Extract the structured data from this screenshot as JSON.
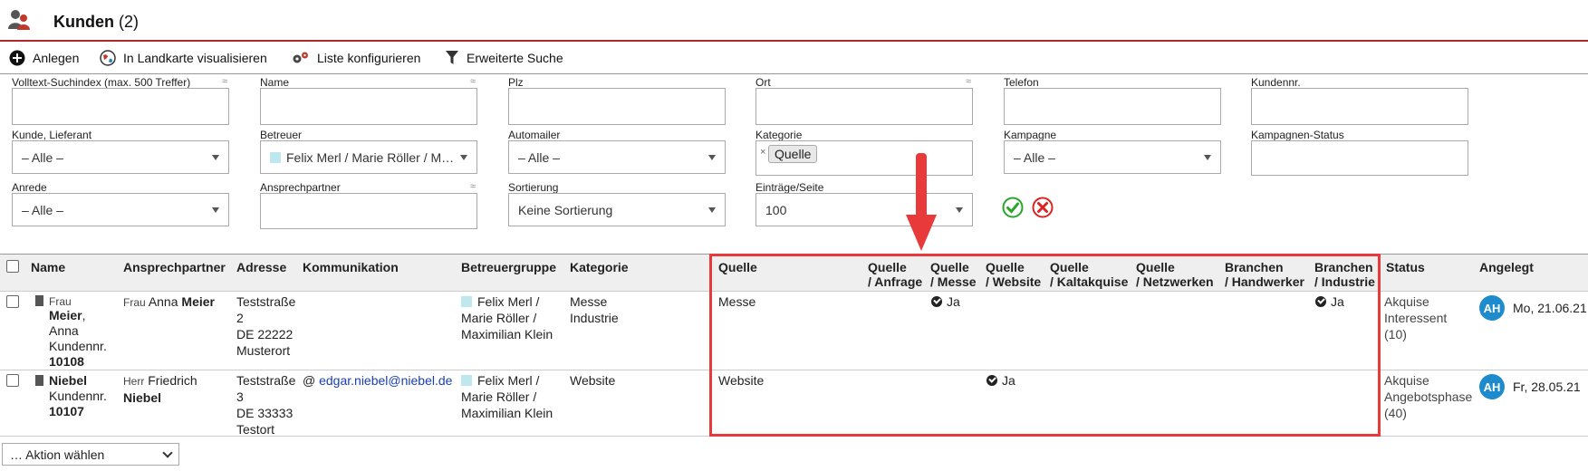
{
  "header": {
    "title": "Kunden",
    "count": "(2)"
  },
  "toolbar": {
    "add_label": "Anlegen",
    "map_label": "In Landkarte visualisieren",
    "configure_label": "Liste konfigurieren",
    "search_label": "Erweiterte Suche"
  },
  "filters": {
    "fulltext_label": "Volltext-Suchindex (max. 500 Treffer)",
    "name_label": "Name",
    "plz_label": "Plz",
    "ort_label": "Ort",
    "telefon_label": "Telefon",
    "kundennr_label": "Kundennr.",
    "kunde_label": "Kunde, Lieferant",
    "kunde_value": "– Alle –",
    "betreuer_label": "Betreuer",
    "betreuer_value": "Felix Merl / Marie Röller / M…",
    "automailer_label": "Automailer",
    "automailer_value": "– Alle –",
    "kategorie_label": "Kategorie",
    "kategorie_tag": "Quelle",
    "kampagne_label": "Kampagne",
    "kampagne_value": "– Alle –",
    "kampagnen_status_label": "Kampagnen-Status",
    "anrede_label": "Anrede",
    "anrede_value": "– Alle –",
    "ansprechpartner_label": "Ansprechpartner",
    "sortierung_label": "Sortierung",
    "sortierung_value": "Keine Sortierung",
    "eintraege_label": "Einträge/Seite",
    "eintraege_value": "100",
    "approx_symbol": "≈",
    "tag_remove": "×"
  },
  "columns": {
    "name": "Name",
    "ansprechpartner": "Ansprechpartner",
    "adresse": "Adresse",
    "kommunikation": "Kommunikation",
    "betreuergruppe": "Betreuergruppe",
    "kategorie": "Kategorie",
    "quelle": "Quelle",
    "q_anfrage_1": "Quelle",
    "q_anfrage_2": "/ Anfrage",
    "q_messe_1": "Quelle",
    "q_messe_2": "/ Messe",
    "q_website_1": "Quelle",
    "q_website_2": "/ Website",
    "q_kalt_1": "Quelle",
    "q_kalt_2": "/ Kaltakquise",
    "q_netz_1": "Quelle",
    "q_netz_2": "/ Netzwerken",
    "b_hand_1": "Branchen",
    "b_hand_2": "/ Handwerker",
    "b_ind_1": "Branchen",
    "b_ind_2": "/ Industrie",
    "status": "Status",
    "angelegt": "Angelegt"
  },
  "rows": [
    {
      "salutation": "Frau",
      "lastname": "Meier",
      "comma": ",",
      "firstname": "Anna",
      "kdnr_label": "Kundennr.",
      "kdnr": "10108",
      "contact_salutation": "Frau",
      "contact_firstname": "Anna",
      "contact_lastname": "Meier",
      "street1": "Teststraße",
      "street2": "2",
      "zip_city1": "DE 22222",
      "zip_city2": "Musterort",
      "email_symbol": "",
      "email": "",
      "group1": "Felix Merl /",
      "group2": "Marie Röller /",
      "group3": "Maximilian Klein",
      "kategorie1": "Messe",
      "kategorie2": "Industrie",
      "quelle": "Messe",
      "q_messe": "Ja",
      "q_website": "",
      "b_industrie": "Ja",
      "status1": "Akquise",
      "status2": "Interessent",
      "status3": "(10)",
      "avatar": "AH",
      "date": "Mo, 21.06.21"
    },
    {
      "salutation": "",
      "lastname": "Niebel",
      "comma": "",
      "firstname": "",
      "kdnr_label": "Kundennr.",
      "kdnr": "10107",
      "contact_salutation": "Herr",
      "contact_firstname": "Friedrich",
      "contact_lastname": "Niebel",
      "street1": "Teststraße",
      "street2": "3",
      "zip_city1": "DE 33333",
      "zip_city2": "Testort",
      "email_symbol": "@",
      "email": "edgar.niebel@niebel.de",
      "group1": "Felix Merl /",
      "group2": "Marie Röller /",
      "group3": "Maximilian Klein",
      "kategorie1": "Website",
      "kategorie2": "",
      "quelle": "Website",
      "q_messe": "",
      "q_website": "Ja",
      "b_industrie": "",
      "status1": "Akquise",
      "status2": "Angebotsphase",
      "status3": "(40)",
      "avatar": "AH",
      "date": "Fr, 28.05.21"
    }
  ],
  "footer": {
    "action_placeholder": "… Aktion wählen"
  },
  "colors": {
    "accent_red": "#b3262d",
    "highlight": "#e8393b",
    "avatar": "#1e8bcd",
    "ok": "#2aa52a",
    "cancel": "#d22"
  }
}
